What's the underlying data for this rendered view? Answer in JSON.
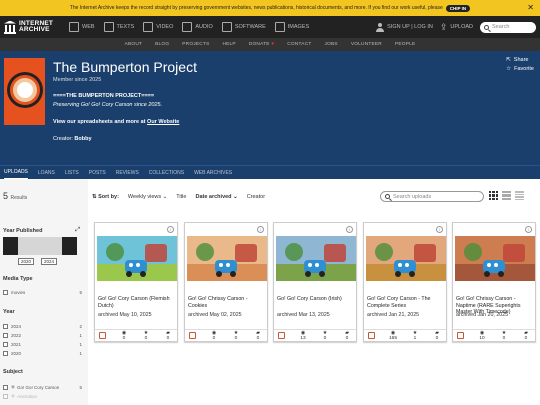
{
  "banner": {
    "message": "The Internet Archive keeps the record straight by preserving government websites, news publications, historical documents, and more. If you find our work useful, please",
    "chip_label": "CHIP IN",
    "close_icon": "close-icon"
  },
  "topnav": {
    "logo_line1": "INTERNET",
    "logo_line2": "ARCHIVE",
    "items": [
      {
        "label": "WEB",
        "icon": "web-icon"
      },
      {
        "label": "TEXTS",
        "icon": "texts-icon"
      },
      {
        "label": "VIDEO",
        "icon": "video-icon"
      },
      {
        "label": "AUDIO",
        "icon": "audio-icon"
      },
      {
        "label": "SOFTWARE",
        "icon": "software-icon"
      },
      {
        "label": "IMAGES",
        "icon": "images-icon"
      }
    ],
    "signin_label": "SIGN UP | LOG IN",
    "upload_label": "UPLOAD",
    "search_placeholder": "Search"
  },
  "subnav": [
    "ABOUT",
    "BLOG",
    "PROJECTS",
    "HELP",
    "DONATE",
    "CONTACT",
    "JOBS",
    "VOLUNTEER",
    "PEOPLE"
  ],
  "profile": {
    "title": "The Bumperton Project",
    "member_since": "Member since 2025",
    "desc1": "====THE BUMPERTON PROJECT====",
    "desc2": "Preserving Go! Go! Cory Carson since 2025.",
    "desc3_prefix": "View our spreadsheets and more at ",
    "desc3_link": "Our Website",
    "creator_label": "Creator:",
    "creator_name": "Bobby",
    "share_label": "Share",
    "favorite_label": "Favorite"
  },
  "tabs": [
    "UPLOADS",
    "LOANS",
    "LISTS",
    "POSTS",
    "REVIEWS",
    "COLLECTIONS",
    "WEB ARCHIVES"
  ],
  "sidebar": {
    "results_count": "5",
    "results_label": "Results",
    "year_published_heading": "Year Published",
    "year_from": "2020",
    "year_to": "2024",
    "media_type_heading": "Media Type",
    "media_types": [
      {
        "label": "movies",
        "count": "5"
      }
    ],
    "year_heading": "Year",
    "years": [
      {
        "label": "2024",
        "count": "2"
      },
      {
        "label": "2022",
        "count": "1"
      },
      {
        "label": "2021",
        "count": "1"
      },
      {
        "label": "2020",
        "count": "1"
      }
    ],
    "subject_heading": "Subject",
    "subjects": [
      {
        "label": "Go! Go! Cory Carson",
        "count": "5"
      },
      {
        "label": "Animation",
        "count": ""
      }
    ]
  },
  "sortbar": {
    "sort_by_label": "Sort by:",
    "options": [
      "Weekly views",
      "Title",
      "Date archived",
      "Creator"
    ],
    "selected": "Date archived",
    "search_placeholder": "Search uploads"
  },
  "cards": [
    {
      "title": "Go! Go! Cory Carson (Flemish Dutch)",
      "date": "archived May 10, 2025",
      "views": "0",
      "favs": "0",
      "reviews": "0",
      "sky": "#6fc3d8",
      "ground": "#9bc74c"
    },
    {
      "title": "Go! Go! Chrissy Carson - Cookies",
      "date": "archived May 02, 2025",
      "views": "0",
      "favs": "0",
      "reviews": "0",
      "sky": "#e9b98a",
      "ground": "#d98f55"
    },
    {
      "title": "Go! Go! Cory Carson (Irish)",
      "date": "archived Mar 13, 2025",
      "views": "13",
      "favs": "0",
      "reviews": "0",
      "sky": "#8fb7d4",
      "ground": "#7da34a"
    },
    {
      "title": "Go! Go! Cory Carson - The Complete Series",
      "date": "archived Jan 21, 2025",
      "views": "165",
      "favs": "1",
      "reviews": "0",
      "sky": "#e3a77c",
      "ground": "#c9913f"
    },
    {
      "title": "Go! Go! Chrissy Carson - Naptime (RARE Superights Master With Timecode)",
      "date": "archived Jan 20, 2025",
      "views": "10",
      "favs": "0",
      "reviews": "0",
      "sky": "#cd7d4f",
      "ground": "#a4573a"
    }
  ]
}
